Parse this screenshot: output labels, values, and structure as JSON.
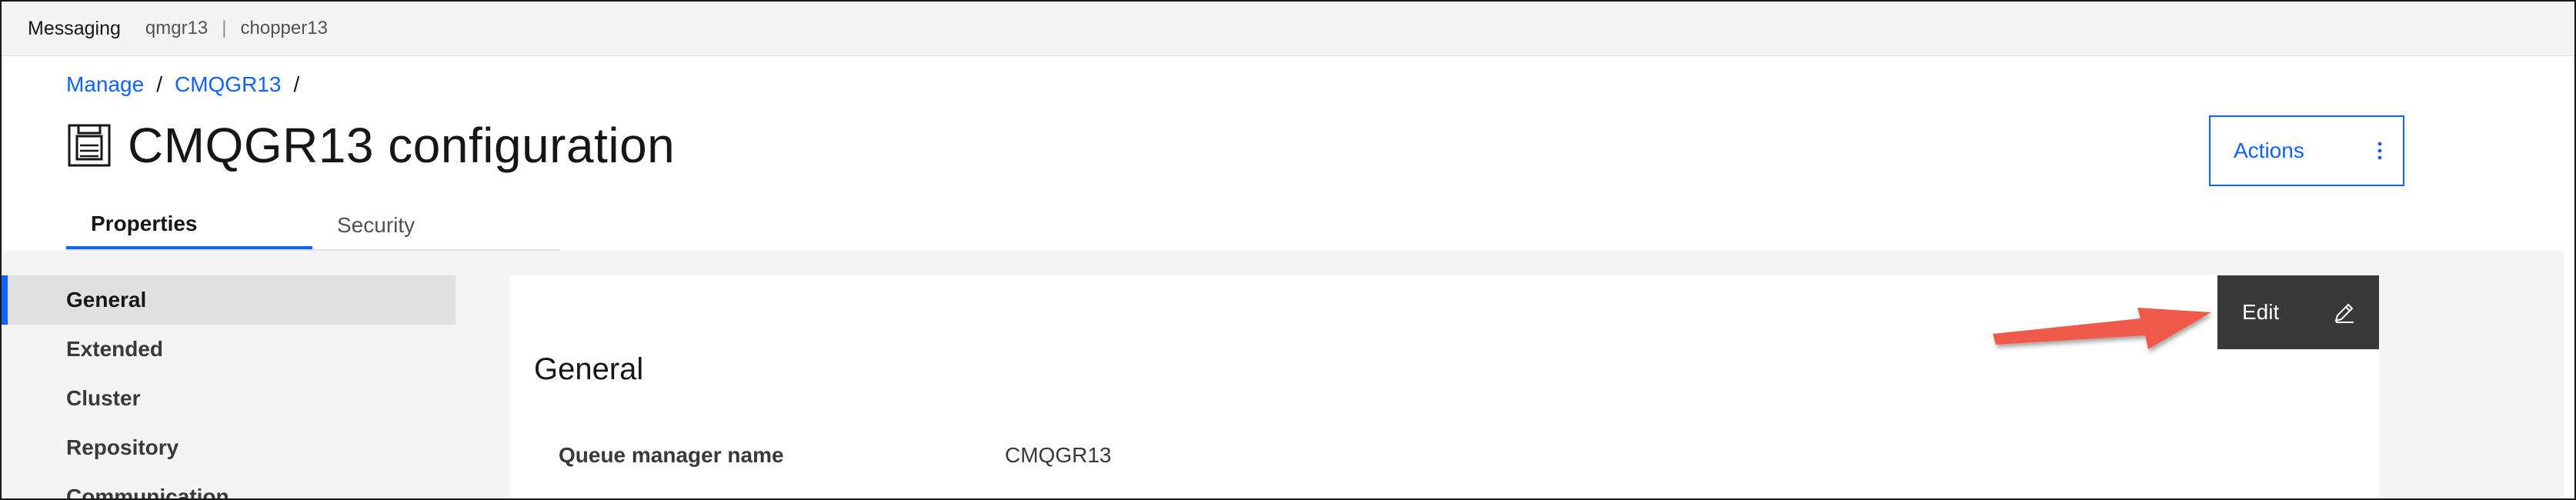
{
  "header": {
    "app_name": "Messaging",
    "queue_manager": "qmgr13",
    "separator": "|",
    "host": "chopper13"
  },
  "breadcrumb": {
    "items": [
      {
        "label": "Manage"
      },
      {
        "label": "CMQGR13"
      }
    ],
    "separator": "/"
  },
  "page": {
    "title": "CMQGR13 configuration",
    "icon": "queue-manager-icon"
  },
  "actions": {
    "label": "Actions",
    "menu_icon": "overflow-menu-icon"
  },
  "tabs": [
    {
      "label": "Properties",
      "active": true
    },
    {
      "label": "Security",
      "active": false
    }
  ],
  "sidenav": {
    "items": [
      {
        "label": "General",
        "active": true
      },
      {
        "label": "Extended",
        "active": false
      },
      {
        "label": "Cluster",
        "active": false
      },
      {
        "label": "Repository",
        "active": false
      },
      {
        "label": "Communication",
        "active": false
      }
    ]
  },
  "panel": {
    "edit_label": "Edit",
    "edit_icon": "pencil-icon",
    "section_title": "General",
    "fields": [
      {
        "label": "Queue manager name",
        "value": "CMQGR13"
      }
    ]
  },
  "annotation": {
    "arrow_color": "#f05a4b"
  },
  "colors": {
    "accent": "#0f62fe",
    "dark_button": "#393939",
    "background_gray": "#f4f4f4"
  }
}
